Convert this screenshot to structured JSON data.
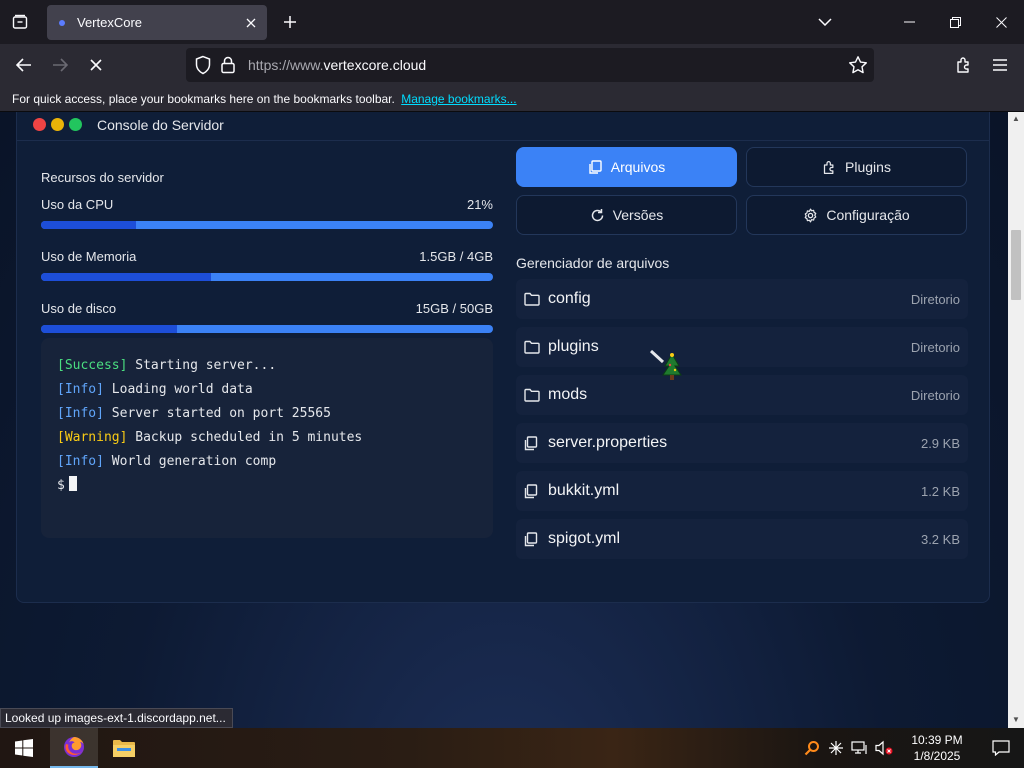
{
  "browser": {
    "tab_title": "VertexCore",
    "url_prefix": "https://www.",
    "url_domain": "vertexcore.cloud",
    "bookmarks_text": "For quick access, place your bookmarks here on the bookmarks toolbar.",
    "bookmarks_link": "Manage bookmarks...",
    "status_text": "Looked up images-ext-1.discordapp.net..."
  },
  "panel": {
    "title": "Console do Servidor"
  },
  "resources": {
    "title": "Recursos do servidor",
    "items": [
      {
        "label": "Uso da CPU",
        "value": "21%",
        "fill": 0.21
      },
      {
        "label": "Uso de Memoria",
        "value": "1.5GB / 4GB",
        "fill": 0.375
      },
      {
        "label": "Uso de disco",
        "value": "15GB / 50GB",
        "fill": 0.3
      }
    ]
  },
  "terminal": {
    "lines": [
      {
        "tag": "[Success]",
        "text": " Starting server..."
      },
      {
        "tag": "[Info]",
        "text": " Loading world data"
      },
      {
        "tag": "[Info]",
        "text": " Server started on port 25565"
      },
      {
        "tag": "[Warning]",
        "text": " Backup scheduled in 5 minutes"
      },
      {
        "tag": "[Info]",
        "text": " World generation comp"
      }
    ],
    "prompt": "$"
  },
  "actions": {
    "files": "Arquivos",
    "plugins": "Plugins",
    "versions": "Versões",
    "config": "Configuração"
  },
  "file_manager": {
    "title": "Gerenciador de arquivos",
    "items": [
      {
        "name": "config",
        "meta": "Diretorio",
        "type": "folder"
      },
      {
        "name": "plugins",
        "meta": "Diretorio",
        "type": "folder"
      },
      {
        "name": "mods",
        "meta": "Diretorio",
        "type": "folder"
      },
      {
        "name": "server.properties",
        "meta": "2.9 KB",
        "type": "file"
      },
      {
        "name": "bukkit.yml",
        "meta": "1.2 KB",
        "type": "file"
      },
      {
        "name": "spigot.yml",
        "meta": "3.2 KB",
        "type": "file"
      }
    ]
  },
  "taskbar": {
    "time": "10:39 PM",
    "date": "1/8/2025"
  },
  "colors": {
    "accent": "#3b82f6",
    "panel_bg": "#0f1e38",
    "success": "#4ade80",
    "info": "#60a5fa",
    "warning": "#facc15"
  }
}
